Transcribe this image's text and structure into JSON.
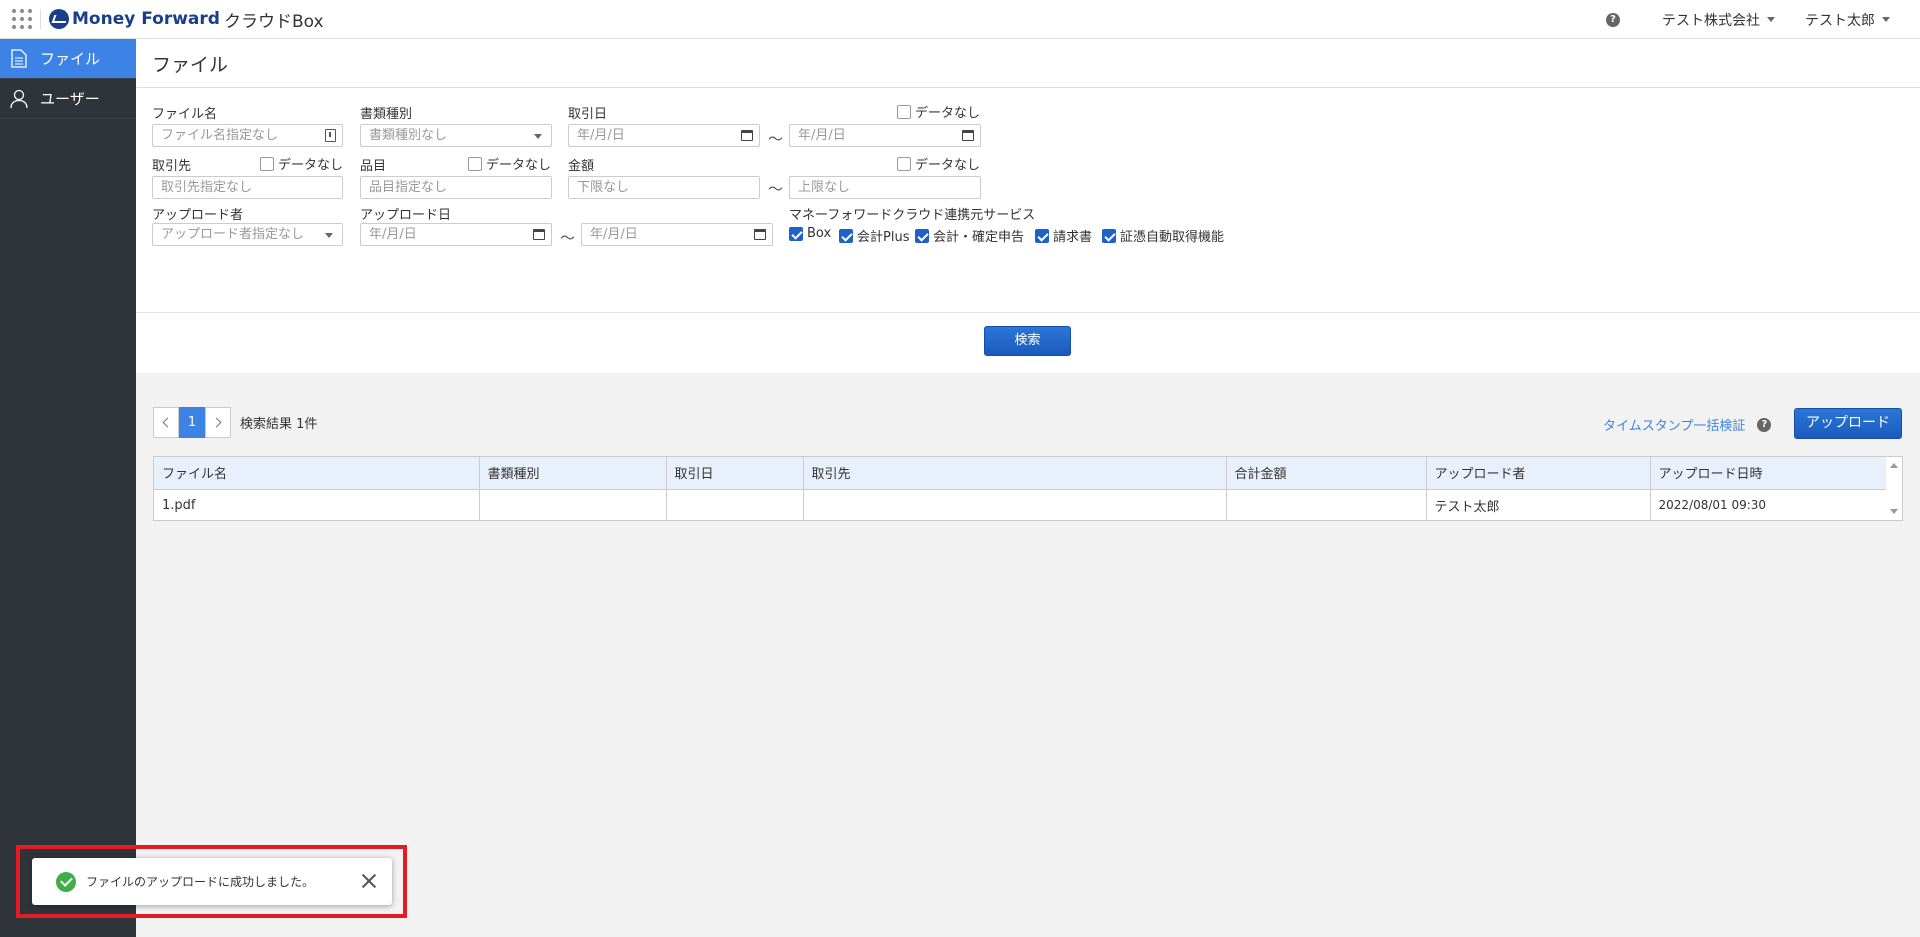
{
  "header": {
    "brand": "Money Forward",
    "product": "クラウドBox",
    "company": "テスト株式会社",
    "user": "テスト太郎"
  },
  "sidebar": {
    "items": [
      {
        "label": "ファイル",
        "icon": "file-icon",
        "active": true
      },
      {
        "label": "ユーザー",
        "icon": "user-icon",
        "active": false
      }
    ]
  },
  "page": {
    "title": "ファイル"
  },
  "filters": {
    "file_name_label": "ファイル名",
    "file_name_placeholder": "ファイル名指定なし",
    "doc_type_label": "書類種別",
    "doc_type_placeholder": "書類種別なし",
    "transaction_date_label": "取引日",
    "date_placeholder": "年/月/日",
    "tilde": "～",
    "no_data": "データなし",
    "partner_label": "取引先",
    "partner_placeholder": "取引先指定なし",
    "item_label": "品目",
    "item_placeholder": "品目指定なし",
    "amount_label": "金額",
    "amount_min_placeholder": "下限なし",
    "amount_max_placeholder": "上限なし",
    "uploader_label": "アップロード者",
    "uploader_placeholder": "アップロード者指定なし",
    "upload_date_label": "アップロード日",
    "services_label": "マネーフォワードクラウド連携元サービス",
    "services": [
      "Box",
      "会計Plus",
      "会計・確定申告",
      "請求書",
      "証憑自動取得機能"
    ]
  },
  "search_button": "検索",
  "results": {
    "current_page": "1",
    "count_text": "検索結果 1件",
    "timestamp_link": "タイムスタンプ一括検証",
    "upload_button": "アップロード",
    "columns": [
      "ファイル名",
      "書類種別",
      "取引日",
      "取引先",
      "合計金額",
      "アップロード者",
      "アップロード日時"
    ],
    "rows": [
      [
        "1.pdf",
        "",
        "",
        "",
        "",
        "テスト太郎",
        "2022/08/01 09:30"
      ]
    ]
  },
  "toast": {
    "message": "ファイルのアップロードに成功しました。"
  },
  "colors": {
    "accent": "#3d83e6",
    "sidebar_bg": "#2f343b",
    "success": "#3fae49",
    "highlight": "#e31b23"
  }
}
